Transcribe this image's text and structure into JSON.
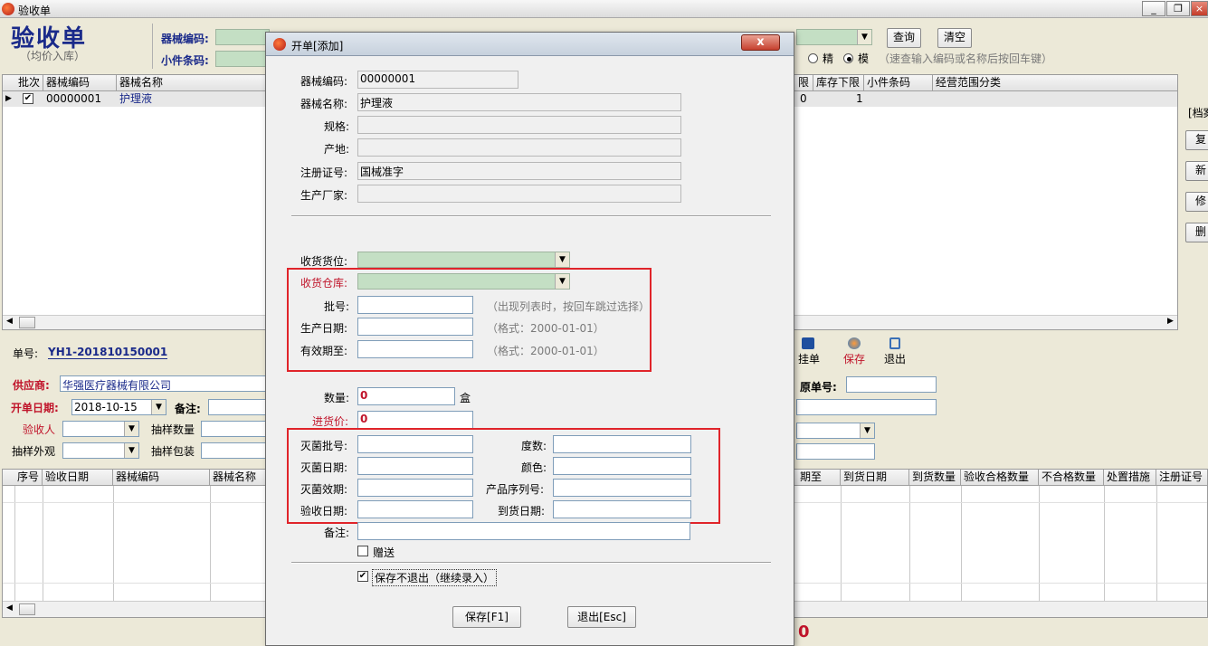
{
  "window": {
    "title": "验收单"
  },
  "header": {
    "big_title": "验收单",
    "subtitle": "（均价入库）",
    "device_code_label": "器械编码:",
    "small_barcode_label": "小件条码:",
    "query_button": "查询",
    "clear_button": "清空",
    "radio_exact": "精",
    "radio_fuzzy": "模",
    "speed_hint": "（速查输入编码或名称后按回车键）"
  },
  "top_grid": {
    "left_columns": [
      "批次",
      "器械编码",
      "器械名称"
    ],
    "right_columns": [
      "限",
      "库存下限",
      "小件条码",
      "经营范围分类"
    ],
    "rows": [
      {
        "checked": true,
        "code": "00000001",
        "name": "护理液",
        "right_a": "0",
        "stock_min": "1"
      }
    ]
  },
  "side_buttons": {
    "archive_label": "[档案",
    "copy": "复",
    "new": "新",
    "modify": "修",
    "delete": "删"
  },
  "order": {
    "no_label": "单号:",
    "no_value": "YH1-201810150001"
  },
  "form": {
    "supplier_label": "供应商:",
    "supplier_value": "华强医疗器械有限公司",
    "open_date_label": "开单日期:",
    "open_date_value": "2018-10-15",
    "remark_label": "备注:",
    "inspector_label": "验收人",
    "sample_qty_label": "抽样数量",
    "sample_look_label": "抽样外观",
    "sample_pack_label": "抽样包装",
    "orig_no_label": "原单号:"
  },
  "toolbar": {
    "hang_label": "挂单",
    "save_label": "保存",
    "exit_label": "退出"
  },
  "bottom_grid": {
    "left_columns": [
      "序号",
      "验收日期",
      "器械编码",
      "器械名称"
    ],
    "right_columns": [
      "期至",
      "到货日期",
      "到货数量",
      "验收合格数量",
      "不合格数量",
      "处置措施",
      "注册证号"
    ]
  },
  "footer": {
    "total_value": "0"
  },
  "dialog": {
    "title": "开单[添加]",
    "close_symbol": "x",
    "device_code_label": "器械编码:",
    "device_code_value": "00000001",
    "device_name_label": "器械名称:",
    "device_name_value": "护理液",
    "spec_label": "规格:",
    "origin_label": "产地:",
    "reg_no_label": "注册证号:",
    "reg_no_value": "国械准字",
    "manufacturer_label": "生产厂家:",
    "recv_location_label": "收货货位:",
    "recv_warehouse_label": "收货仓库:",
    "batch_label": "批号:",
    "batch_hint": "（出现列表时，按回车跳过选择）",
    "prod_date_label": "生产日期:",
    "prod_date_hint": "（格式：2000-01-01）",
    "valid_until_label": "有效期至:",
    "valid_until_hint": "（格式：2000-01-01）",
    "qty_label": "数量:",
    "qty_value": "0",
    "qty_unit": "盒",
    "price_label": "进货价:",
    "price_value": "0",
    "steril_batch_label": "灭菌批号:",
    "degree_label": "度数:",
    "steril_date_label": "灭菌日期:",
    "color_label": "颜色:",
    "steril_valid_label": "灭菌效期:",
    "serial_label": "产品序列号:",
    "inspect_date_label": "验收日期:",
    "arrival_date_label": "到货日期:",
    "note_label": "备注:",
    "gift_label": "赠送",
    "gift_checked": false,
    "keep_open_label": "保存不退出（继续录入）",
    "keep_open_checked": true,
    "save_button": "保存[F1]",
    "exit_button": "退出[Esc]"
  }
}
